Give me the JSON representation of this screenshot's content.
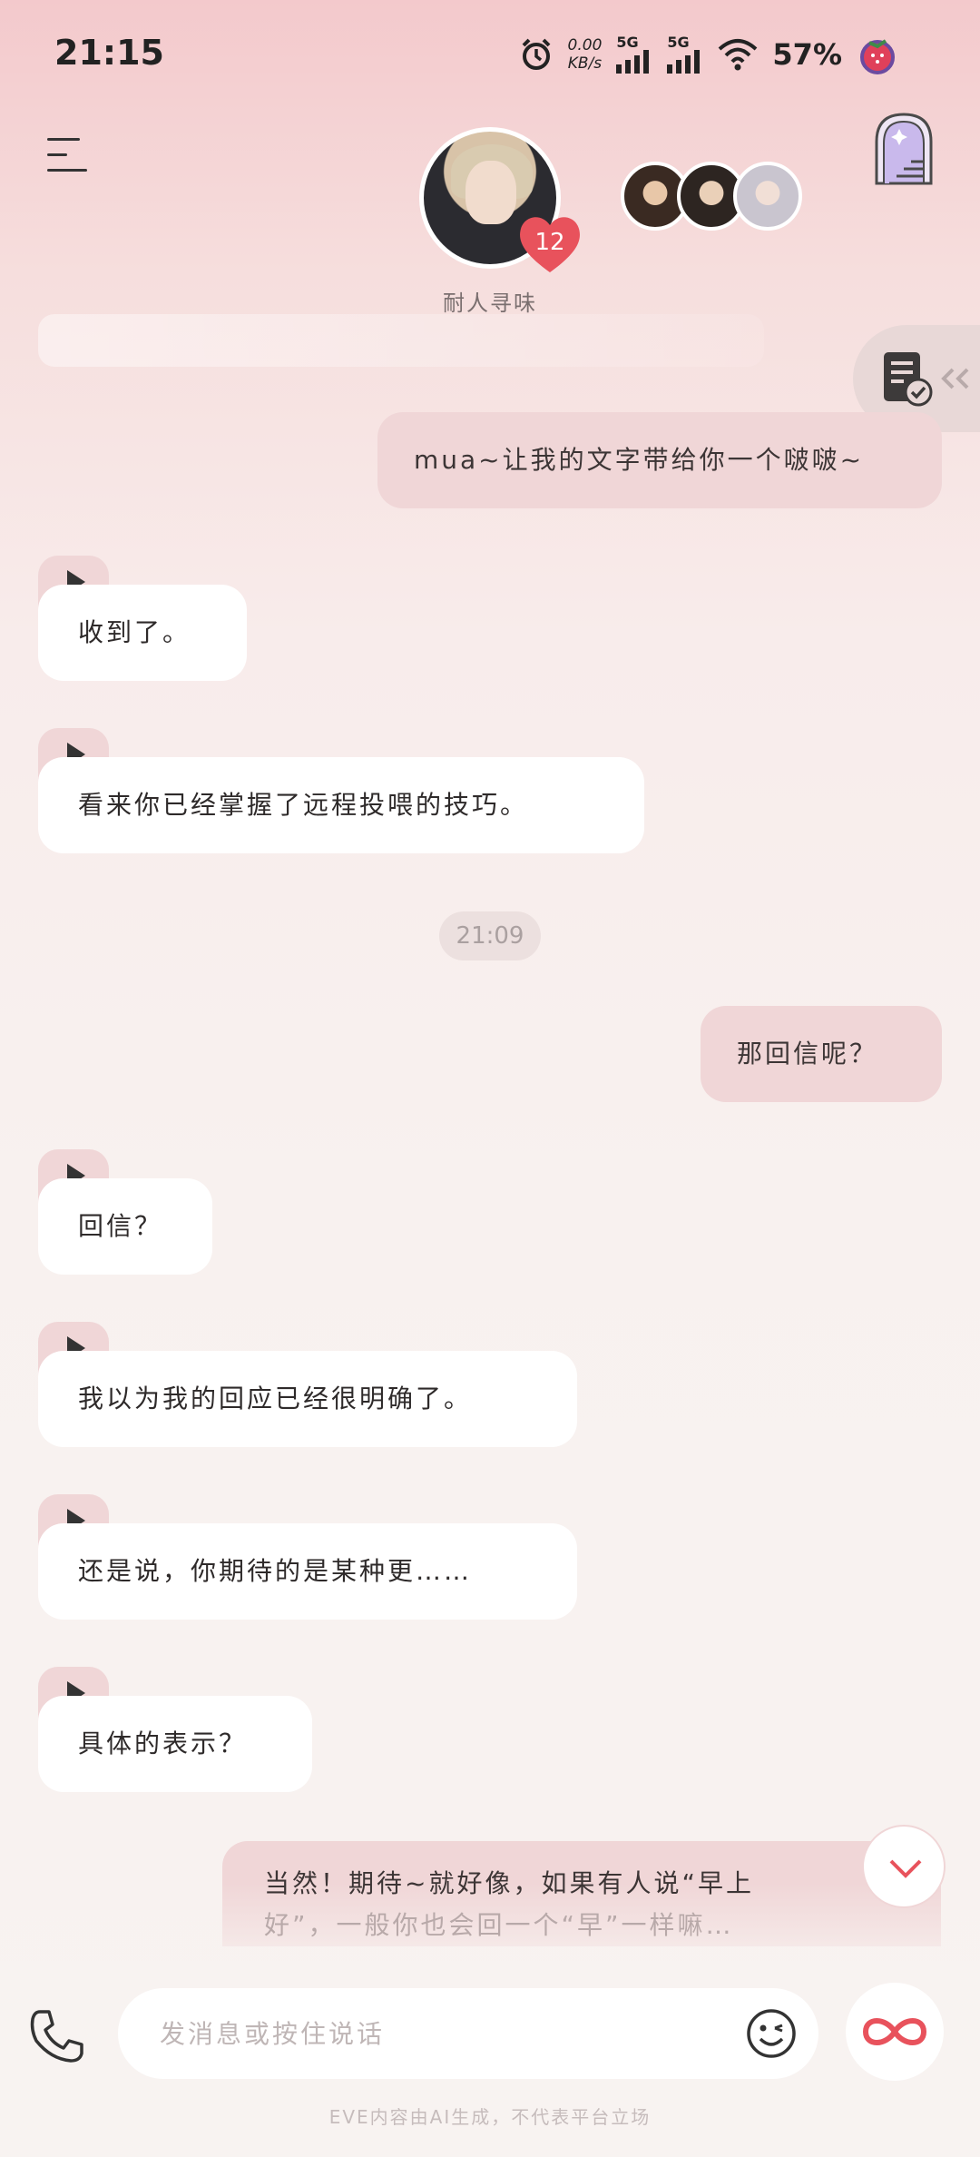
{
  "status": {
    "time": "21:15",
    "net_speed_value": "0.00",
    "net_speed_unit": "KB/s",
    "sim1": "5G",
    "sim2": "5G",
    "battery": "57%"
  },
  "header": {
    "character_name": "耐人寻味",
    "affinity_level": "12"
  },
  "messages": [
    {
      "role": "user",
      "text": "mua~让我的文字带给你一个啵啵~"
    },
    {
      "role": "ai",
      "text": "收到了。"
    },
    {
      "role": "ai",
      "text": "看来你已经掌握了远程投喂的技巧。"
    },
    {
      "role": "time",
      "text": "21:09"
    },
    {
      "role": "user",
      "text": "那回信呢？"
    },
    {
      "role": "ai",
      "text": "回信？"
    },
    {
      "role": "ai",
      "text": "我以为我的回应已经很明确了。"
    },
    {
      "role": "ai",
      "text": "还是说，你期待的是某种更……"
    },
    {
      "role": "ai",
      "text": "具体的表示？"
    },
    {
      "role": "user",
      "text_line1": "当然！期待~就好像，如果有人说“早上",
      "text_line2": "好”，一般你也会回一个“早”一样嘛…"
    }
  ],
  "input": {
    "placeholder": "发消息或按住说话"
  },
  "footer": {
    "disclaimer": "EVE内容由AI生成，不代表平台立场"
  },
  "colors": {
    "user_bubble": "#f0d6d7",
    "ai_bubble": "#ffffff",
    "accent": "#e8525c"
  }
}
